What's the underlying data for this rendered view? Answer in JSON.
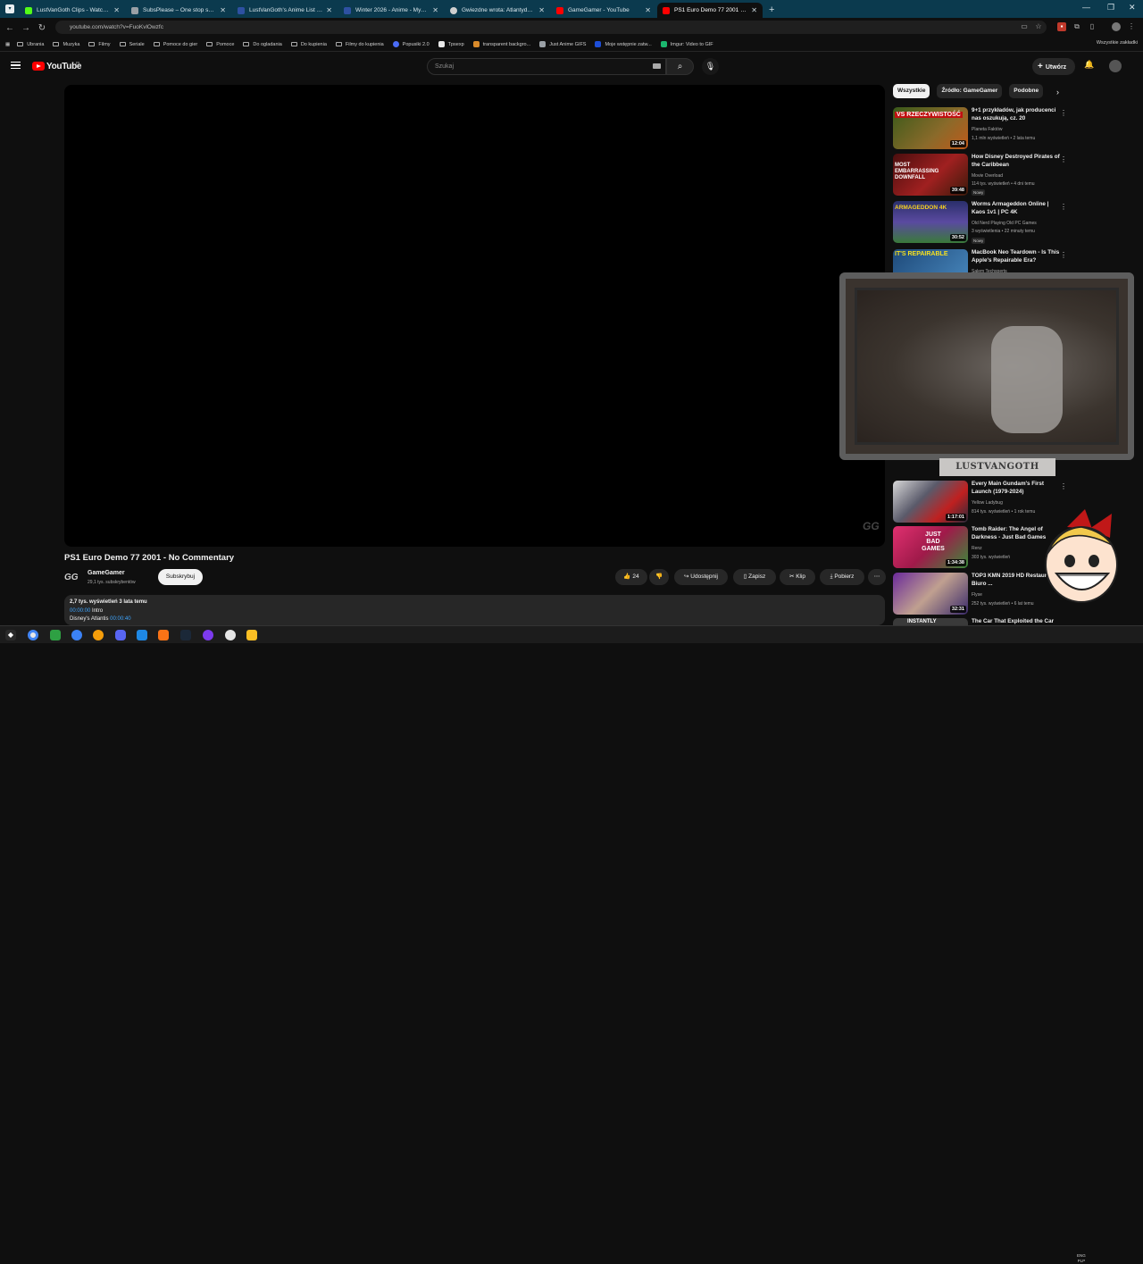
{
  "browser": {
    "tabs": [
      {
        "title": "LustVanGoth Clips - Watch Live",
        "color": "#53fc18"
      },
      {
        "title": "SubsPlease – One stop shop for",
        "color": "#9aa0a6"
      },
      {
        "title": "LustVanGoth's Anime List - My",
        "color": "#2e51a2"
      },
      {
        "title": "Winter 2026 - Anime - MyAnime",
        "color": "#2e51a2"
      },
      {
        "title": "Gwiezdne wrota: Atlantyda / St",
        "color": "#cfcfcf"
      },
      {
        "title": "GameGamer - YouTube",
        "color": "#ff0000"
      },
      {
        "title": "PS1 Euro Demo 77 2001 - No C",
        "color": "#ff0000"
      }
    ],
    "new_tab": "+",
    "url": "youtube.com/watch?v=FuoKvlOwzfc",
    "bookmarks": [
      {
        "label": "Ubrania",
        "type": "folder"
      },
      {
        "label": "Muzyka",
        "type": "folder"
      },
      {
        "label": "Filmy",
        "type": "folder"
      },
      {
        "label": "Seriale",
        "type": "folder"
      },
      {
        "label": "Pomoce do gier",
        "type": "folder"
      },
      {
        "label": "Pomoce",
        "type": "folder"
      },
      {
        "label": "Do ogladania",
        "type": "folder"
      },
      {
        "label": "Do kupienia",
        "type": "folder"
      },
      {
        "label": "Filmy do kupienia",
        "type": "folder"
      },
      {
        "label": "Popusiki 2.0",
        "type": "site",
        "color": "#4a6cf7"
      },
      {
        "label": "Tpsexp",
        "type": "site",
        "color": "#e8e8e8"
      },
      {
        "label": "transparent backgro...",
        "type": "site",
        "color": "#d98b2b"
      },
      {
        "label": "Just Anime GIFS",
        "type": "site",
        "color": "#9aa0a6"
      },
      {
        "label": "Moje wstępnie zatw...",
        "type": "site",
        "color": "#1d4ed8"
      },
      {
        "label": "Imgur: Video to GIF",
        "type": "site",
        "color": "#1bb76e"
      }
    ],
    "bookmarks_all": "Wszystkie zakładki"
  },
  "youtube": {
    "logo_text": "YouTube",
    "logo_country": "PL",
    "search_placeholder": "Szukaj",
    "create_label": "Utwórz",
    "video": {
      "title": "PS1 Euro Demo 77 2001 - No Commentary",
      "watermark": "GG",
      "channel_logo": "GG",
      "channel_name": "GameGamer",
      "channel_subs": "29,1 tys. subskrybentów",
      "subscribe_label": "Subskrybuj",
      "likes": "24",
      "share_label": "Udostępnij",
      "save_label": "Zapisz",
      "clip_label": "Klip",
      "download_label": "Pobierz",
      "desc_meta": "2,7 tys. wyświetleń  3 lata temu",
      "chapters": [
        {
          "time": "00:00:00",
          "label": "Intro"
        },
        {
          "time": "00:00:40",
          "label": "Disney's Atlantis"
        }
      ]
    },
    "chips": [
      "Wszystkie",
      "Źródło: GameGamer",
      "Podobne"
    ],
    "recommendations": [
      {
        "title": "9+1 przykładów, jak producenci nas oszukują, cz. 20",
        "channel": "Planeta Faktów",
        "meta": "1,1 mln wyświetleń • 2 lata temu",
        "duration": "12:04",
        "new": "",
        "thumb_text": "VS RZECZYWISTOŚĆ",
        "thumb_color": "#7a5a2a"
      },
      {
        "title": "How Disney Destroyed Pirates of the Caribbean",
        "channel": "Movie Overload",
        "meta": "114 tys. wyświetleń • 4 dni temu",
        "duration": "39:48",
        "new": "Nowy",
        "thumb_text": "MOST EMBARRASSING DOWNFALL",
        "thumb_color": "#8a1e1e"
      },
      {
        "title": "Worms Armageddon Online | Kaos 1v1 | PC 4K",
        "channel": "Old Nerd Playing Old PC Games",
        "meta": "3 wyświetlenia • 22 minuty temu",
        "duration": "30:52",
        "new": "Nowy",
        "thumb_text": "ARMAGEDDON 4K",
        "thumb_color": "#3a3f7a"
      },
      {
        "title": "MacBook Neo Teardown - Is This Apple's Repairable Era?",
        "channel": "Salem Techsperts",
        "meta": "",
        "duration": "",
        "new": "",
        "thumb_text": "IT'S REPAIRABLE",
        "thumb_color": "#2f5a8a"
      },
      {
        "title": "Every Main Gundam's First Launch (1979-2024)",
        "channel": "Yellow Ladybug",
        "meta": "814 tys. wyświetleń • 1 rok temu",
        "duration": "1:17:01",
        "new": "",
        "thumb_text": "",
        "thumb_color": "#6b6b75"
      },
      {
        "title": "Tomb Raider: The Angel of Darkness - Just Bad Games",
        "channel": "Renz",
        "meta": "303 tys. wyświetleń",
        "duration": "1:34:38",
        "new": "",
        "thumb_text": "JUST BAD GAMES",
        "thumb_color": "#c21a4a"
      },
      {
        "title": "TOP3 KMN 2019 HD Restauracja, Biuro ...",
        "channel": "Flyse",
        "meta": "252 tys. wyświetleń • 6 lat temu",
        "duration": "32:31",
        "new": "",
        "thumb_text": "",
        "thumb_color": "#5a2a8a"
      },
      {
        "title": "The Car That Exploited the Car",
        "channel": "",
        "meta": "",
        "duration": "",
        "new": "",
        "thumb_text": "INSTANTLY",
        "thumb_color": "#3a3a3a"
      }
    ]
  },
  "overlay": {
    "banner": "LUSTVANGOTH"
  },
  "taskbar": {
    "lang": "ENG",
    "sublang": "PLP"
  }
}
